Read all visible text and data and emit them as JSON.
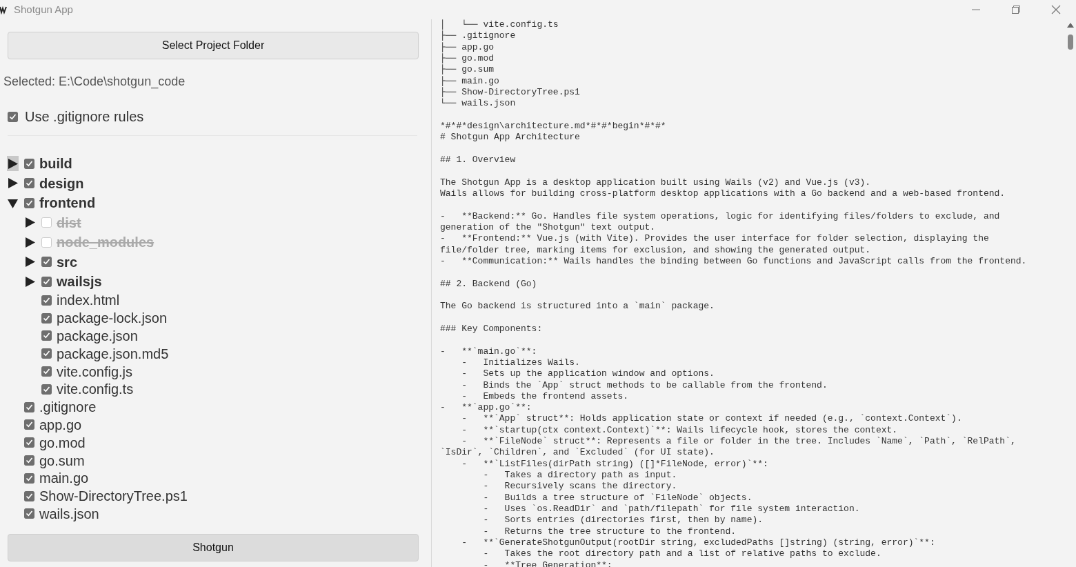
{
  "window": {
    "title": "Shotgun App"
  },
  "select_button": "Select Project Folder",
  "selected_path": "Selected: E:\\Code\\shotgun_code",
  "gitignore_option": {
    "label": "Use .gitignore rules",
    "checked": true
  },
  "tree": [
    {
      "kind": "folder",
      "name": "build",
      "checked": true,
      "expanded": false,
      "focused": true
    },
    {
      "kind": "folder",
      "name": "design",
      "checked": true,
      "expanded": false,
      "focused": false
    },
    {
      "kind": "folder",
      "name": "frontend",
      "checked": true,
      "expanded": true,
      "focused": false,
      "children": [
        {
          "kind": "folder",
          "name": "dist",
          "checked": false,
          "expanded": false,
          "focused": false
        },
        {
          "kind": "folder",
          "name": "node_modules",
          "checked": false,
          "expanded": false,
          "focused": false
        },
        {
          "kind": "folder",
          "name": "src",
          "checked": true,
          "expanded": false,
          "focused": false
        },
        {
          "kind": "folder",
          "name": "wailsjs",
          "checked": true,
          "expanded": false,
          "focused": false
        },
        {
          "kind": "file",
          "name": "index.html",
          "checked": true
        },
        {
          "kind": "file",
          "name": "package-lock.json",
          "checked": true
        },
        {
          "kind": "file",
          "name": "package.json",
          "checked": true
        },
        {
          "kind": "file",
          "name": "package.json.md5",
          "checked": true
        },
        {
          "kind": "file",
          "name": "vite.config.js",
          "checked": true
        },
        {
          "kind": "file",
          "name": "vite.config.ts",
          "checked": true
        }
      ]
    },
    {
      "kind": "file",
      "name": ".gitignore",
      "checked": true
    },
    {
      "kind": "file",
      "name": "app.go",
      "checked": true
    },
    {
      "kind": "file",
      "name": "go.mod",
      "checked": true
    },
    {
      "kind": "file",
      "name": "go.sum",
      "checked": true
    },
    {
      "kind": "file",
      "name": "main.go",
      "checked": true
    },
    {
      "kind": "file",
      "name": "Show-DirectoryTree.ps1",
      "checked": true
    },
    {
      "kind": "file",
      "name": "wails.json",
      "checked": true
    }
  ],
  "shotgun_button": "Shotgun",
  "output_blocks": [
    [
      "│   └── vite.config.ts",
      "├── .gitignore",
      "├── app.go",
      "├── go.mod",
      "├── go.sum",
      "├── main.go",
      "├── Show-DirectoryTree.ps1",
      "└── wails.json"
    ],
    [
      "*#*#*design\\architecture.md*#*#*begin*#*#*",
      "# Shotgun App Architecture"
    ],
    [
      "## 1. Overview"
    ],
    [
      "The Shotgun App is a desktop application built using Wails (v2) and Vue.js (v3).",
      "Wails allows for building cross-platform desktop applications with a Go backend and a web-based frontend."
    ],
    [
      "-   **Backend:** Go. Handles file system operations, logic for identifying files/folders to exclude, and",
      "generation of the \"Shotgun\" text output.",
      "-   **Frontend:** Vue.js (with Vite). Provides the user interface for folder selection, displaying the",
      "file/folder tree, marking items for exclusion, and showing the generated output.",
      "-   **Communication:** Wails handles the binding between Go functions and JavaScript calls from the frontend."
    ],
    [
      "## 2. Backend (Go)"
    ],
    [
      "The Go backend is structured into a `main` package."
    ],
    [
      "### Key Components:"
    ],
    [
      "-   **`main.go`**:",
      "    -   Initializes Wails.",
      "    -   Sets up the application window and options.",
      "    -   Binds the `App` struct methods to be callable from the frontend.",
      "    -   Embeds the frontend assets.",
      "-   **`app.go`**:",
      "    -   **`App` struct**: Holds application state or context if needed (e.g., `context.Context`).",
      "    -   **`startup(ctx context.Context)`**: Wails lifecycle hook, stores the context.",
      "    -   **`FileNode` struct**: Represents a file or folder in the tree. Includes `Name`, `Path`, `RelPath`,",
      "`IsDir`, `Children`, and `Excluded` (for UI state).",
      "    -   **`ListFiles(dirPath string) ([]*FileNode, error)`**:",
      "        -   Takes a directory path as input.",
      "        -   Recursively scans the directory.",
      "        -   Builds a tree structure of `FileNode` objects.",
      "        -   Uses `os.ReadDir` and `path/filepath` for file system interaction.",
      "        -   Sorts entries (directories first, then by name).",
      "        -   Returns the tree structure to the frontend.",
      "    -   **`GenerateShotgunOutput(rootDir string, excludedPaths []string) (string, error)`**:",
      "        -   Takes the root directory path and a list of relative paths to exclude.",
      "        -   **Tree Generation**:"
    ]
  ]
}
